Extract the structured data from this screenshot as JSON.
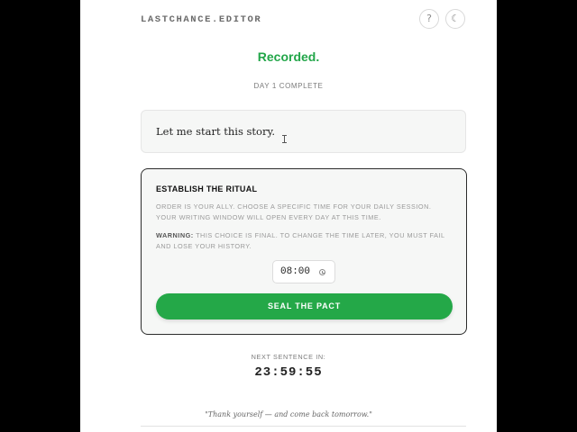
{
  "header": {
    "brand": "LASTCHANCE.EDITOR",
    "help_icon": "?",
    "theme_icon": "☾"
  },
  "status": {
    "title": "Recorded.",
    "subtitle": "DAY 1 COMPLETE"
  },
  "story": {
    "text": "Let me start this story."
  },
  "ritual": {
    "title": "ESTABLISH THE RITUAL",
    "body": "ORDER IS YOUR ALLY. CHOOSE A SPECIFIC TIME FOR YOUR DAILY SESSION. YOUR WRITING WINDOW WILL OPEN EVERY DAY AT THIS TIME.",
    "warning_label": "WARNING:",
    "warning_text": " THIS CHOICE IS FINAL. TO CHANGE THE TIME LATER, YOU MUST FAIL AND LOSE YOUR HISTORY.",
    "time_value": "08:00",
    "button_label": "SEAL THE PACT"
  },
  "countdown": {
    "label": "NEXT SENTENCE IN:",
    "value": "23:59:55"
  },
  "footer": {
    "quote": "\"Thank yourself — and come back tomorrow.\""
  },
  "colors": {
    "accent_green": "#24a848",
    "status_green": "#22a649"
  }
}
